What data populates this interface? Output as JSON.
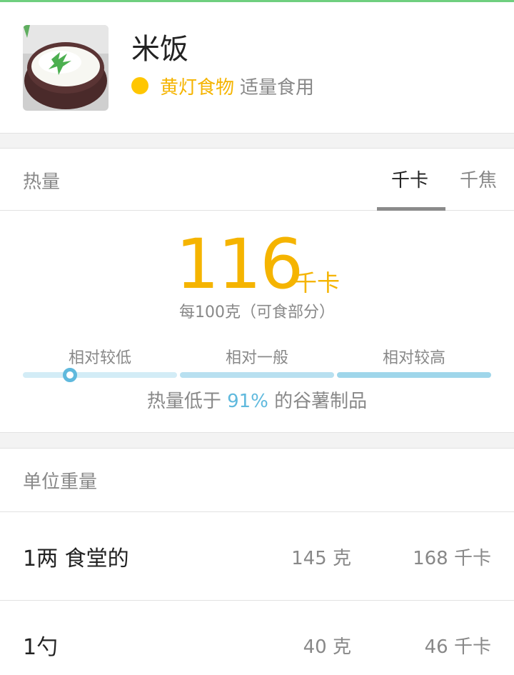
{
  "food": {
    "name": "米饭",
    "light_label": "黄灯食物",
    "advice": "适量食用",
    "light_color": "#ffc600"
  },
  "energy": {
    "title": "热量",
    "tabs": [
      {
        "label": "千卡",
        "active": true
      },
      {
        "label": "千焦",
        "active": false
      }
    ],
    "value": "116",
    "unit": "千卡",
    "per_note": "每100克（可食部分）",
    "levels": [
      "相对较低",
      "相对一般",
      "相对较高"
    ],
    "level_fraction": 0.1,
    "compare_prefix": "热量低于",
    "compare_pct": "91%",
    "compare_suffix": "的谷薯制品",
    "accent_color": "#f5b400",
    "indicator_color": "#5fb9dd"
  },
  "unit_weight": {
    "title": "单位重量",
    "rows": [
      {
        "name": "1两 食堂的",
        "weight": "145 克",
        "energy": "168 千卡"
      },
      {
        "name": "1勺",
        "weight": "40 克",
        "energy": "46 千卡"
      }
    ]
  }
}
